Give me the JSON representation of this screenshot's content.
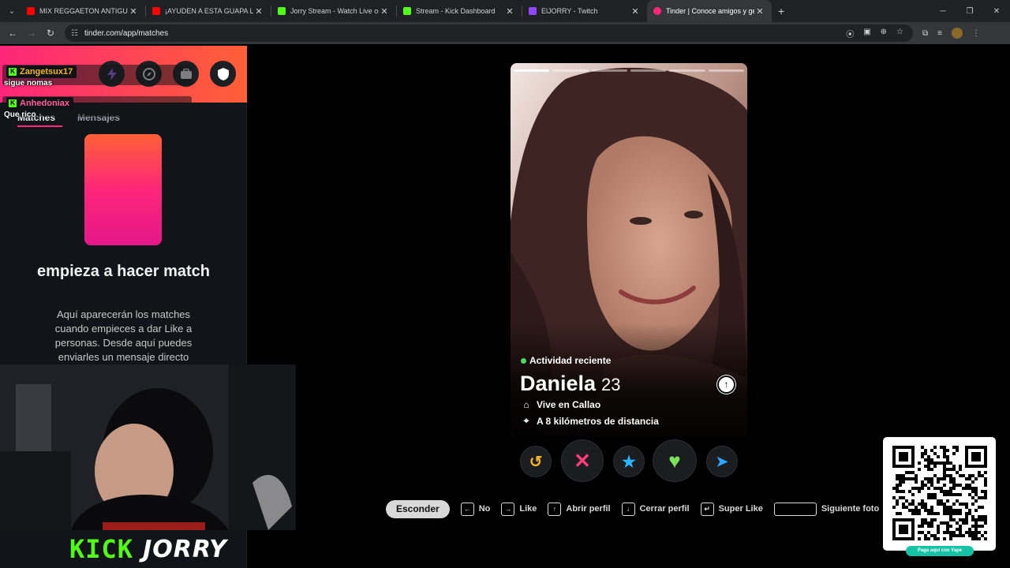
{
  "browser": {
    "tabs": [
      {
        "title": "MIX REGGAETON ANTIGUO ROCK",
        "favicon": "youtube-icon",
        "color": "#ff0000"
      },
      {
        "title": "¡AYUDEN A ESTA GUAPA L",
        "favicon": "youtube-icon",
        "color": "#ff0000"
      },
      {
        "title": "Jorry Stream - Watch Live on Kick",
        "favicon": "kick-icon",
        "color": "#53fc18"
      },
      {
        "title": "Stream - Kick Dashboard",
        "favicon": "kick-icon",
        "color": "#53fc18"
      },
      {
        "title": "ElJORRY - Twitch",
        "favicon": "twitch-icon",
        "color": "#9146ff"
      },
      {
        "title": "Tinder | Conoce amigos y gente",
        "favicon": "tinder-icon",
        "color": "#fd267a",
        "active": true
      }
    ],
    "url": "tinder.com/app/matches"
  },
  "sidebar": {
    "tabs": {
      "matches": "Matches",
      "messages": "Mensajes"
    },
    "empty_title": "empieza a hacer match",
    "empty_desc": "Aquí aparecerán los matches cuando empieces a dar Like a personas. Desde aquí puedes enviarles un mensaje directo"
  },
  "chat": [
    {
      "user": "Zangetsux17",
      "user_color": "#f0b61f",
      "message": "sigue nomas"
    },
    {
      "user": "Anhedoniax",
      "user_color": "#ff5f9a",
      "message": "Que rico"
    }
  ],
  "profile": {
    "activity": "Actividad reciente",
    "name": "Daniela",
    "age": "23",
    "lives": "Vive en Callao",
    "distance": "A 8 kilómetros de distancia",
    "photo_count": 6,
    "photo_index": 0
  },
  "shortcuts": {
    "hide": "Esconder",
    "no": "No",
    "like": "Like",
    "open_profile": "Abrir perfil",
    "close_profile": "Cerrar perfil",
    "super_like": "Super Like",
    "next_photo": "Siguiente foto"
  },
  "stream": {
    "platform": "KICK",
    "streamer": "JORRY",
    "qr_caption": "Paga aquí con Yape"
  },
  "colors": {
    "tinder_gradient_start": "#fd267a",
    "tinder_gradient_end": "#ff6036",
    "kick_green": "#53fc18"
  }
}
